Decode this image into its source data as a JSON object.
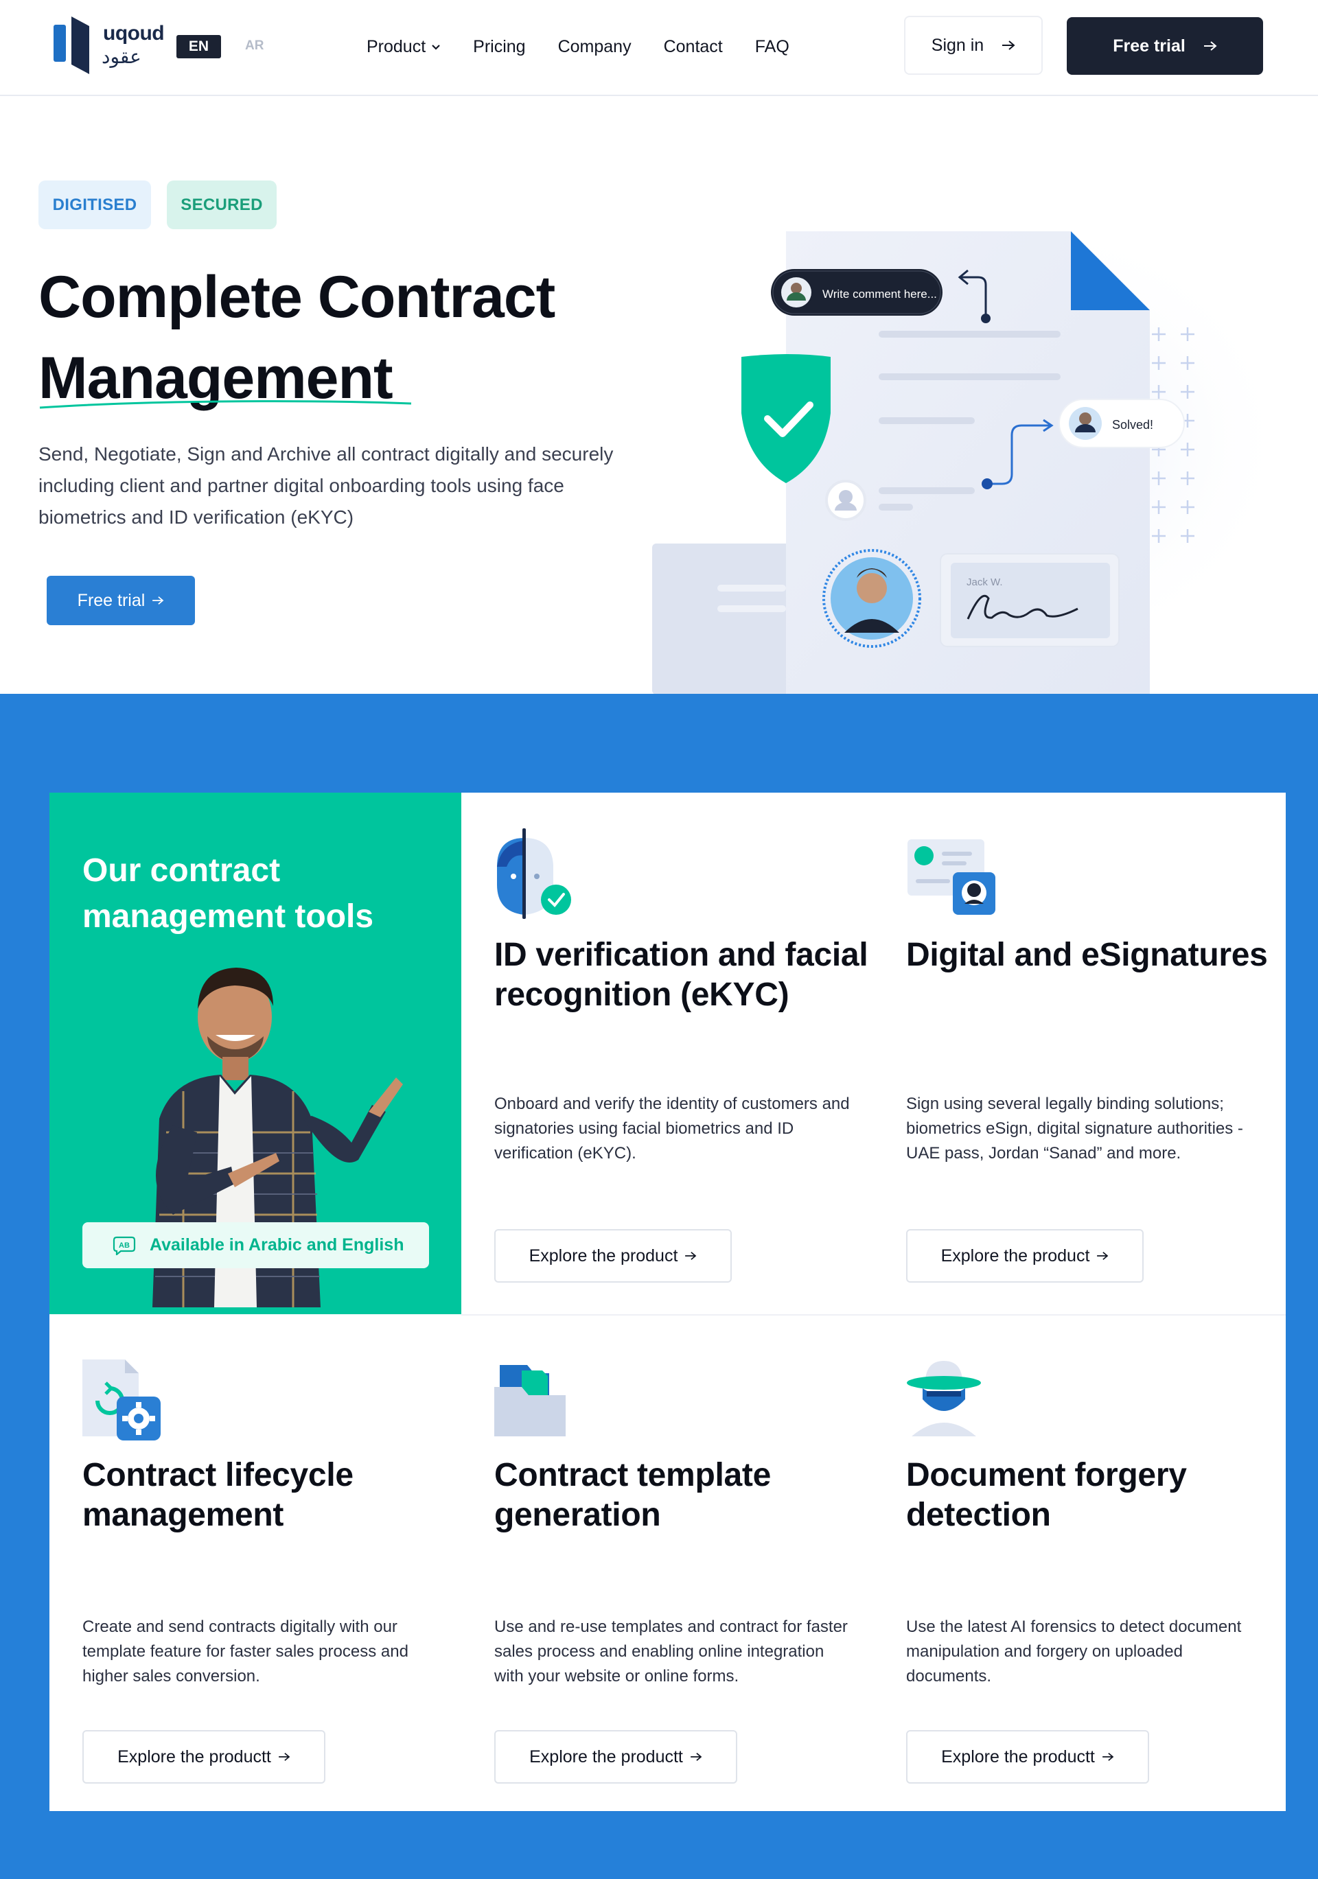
{
  "header": {
    "logo_en": "uqoud",
    "logo_ar": "عقود",
    "lang_active": "EN",
    "lang_other": "AR",
    "nav": [
      "Product",
      "Pricing",
      "Company",
      "Contact",
      "FAQ"
    ],
    "sign_in": "Sign in",
    "free_trial": "Free trial"
  },
  "hero": {
    "badges": [
      "DIGITISED",
      "SECURED"
    ],
    "title_line1": "Complete Contract",
    "title_line2": "Management",
    "description": "Send, Negotiate, Sign and Archive all contract digitally and securely including client and partner digital onboarding tools using face biometrics and ID verification (eKYC)",
    "cta": "Free trial",
    "illustration": {
      "comment_placeholder": "Write comment here...",
      "solved_label": "Solved!",
      "signature_name": "Jack W."
    }
  },
  "tools": {
    "heading": "Our contract management tools",
    "availability": "Available in Arabic and English",
    "cards": [
      {
        "icon": "face-id-icon",
        "title": "ID verification and facial recognition (eKYC)",
        "description": "Onboard and verify the identity of customers and signatories using facial biometrics and ID verification (eKYC).",
        "button": "Explore the product"
      },
      {
        "icon": "esignature-icon",
        "title": "Digital and eSignatures",
        "description": "Sign using several legally binding solutions; biometrics eSign, digital signature authorities - UAE pass, Jordan “Sanad” and more.",
        "button": "Explore the product"
      },
      {
        "icon": "contract-lifecycle-icon",
        "title": "Contract lifecycle management",
        "description": "Create and send contracts digitally with our template feature for faster sales process and higher sales conversion.",
        "button": "Explore the productt"
      },
      {
        "icon": "template-folder-icon",
        "title": "Contract template generation",
        "description": "Use and re-use templates and contract for faster sales process and enabling online integration with your website or online forms.",
        "button": "Explore the productt"
      },
      {
        "icon": "forgery-detective-icon",
        "title": "Document forgery detection",
        "description": "Use the latest AI forensics to detect document manipulation and forgery on uploaded documents.",
        "button": "Explore the productt"
      }
    ]
  },
  "colors": {
    "dark": "#1b2232",
    "brand_blue": "#2580d9",
    "brand_green": "#00c59d"
  }
}
